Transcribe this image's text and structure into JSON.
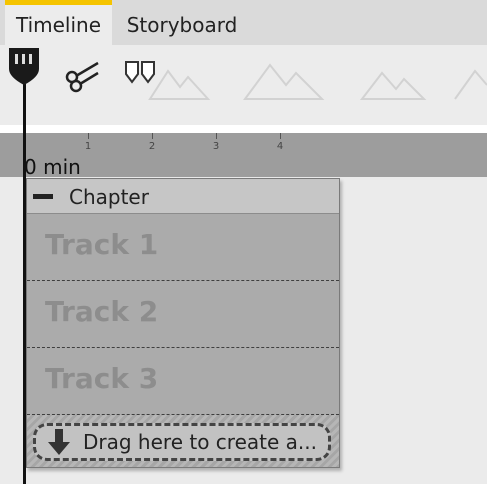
{
  "tabs": [
    {
      "label": "Timeline",
      "active": true
    },
    {
      "label": "Storyboard",
      "active": false
    }
  ],
  "toolbar": {
    "cut_icon": "scissors-icon",
    "marker_icon": "split-marker-icon"
  },
  "ruler": {
    "ticks": [
      "1",
      "2",
      "3",
      "4"
    ],
    "start_label": "0 min"
  },
  "chapter": {
    "title": "Chapter",
    "tracks": [
      "Track 1",
      "Track 2",
      "Track 3"
    ],
    "drop_label": "Drag here to create a..."
  },
  "colors": {
    "active_tab_accent": "#f5c400",
    "ruler": "#9d9d9d",
    "chapter_bg": "#ababab"
  }
}
